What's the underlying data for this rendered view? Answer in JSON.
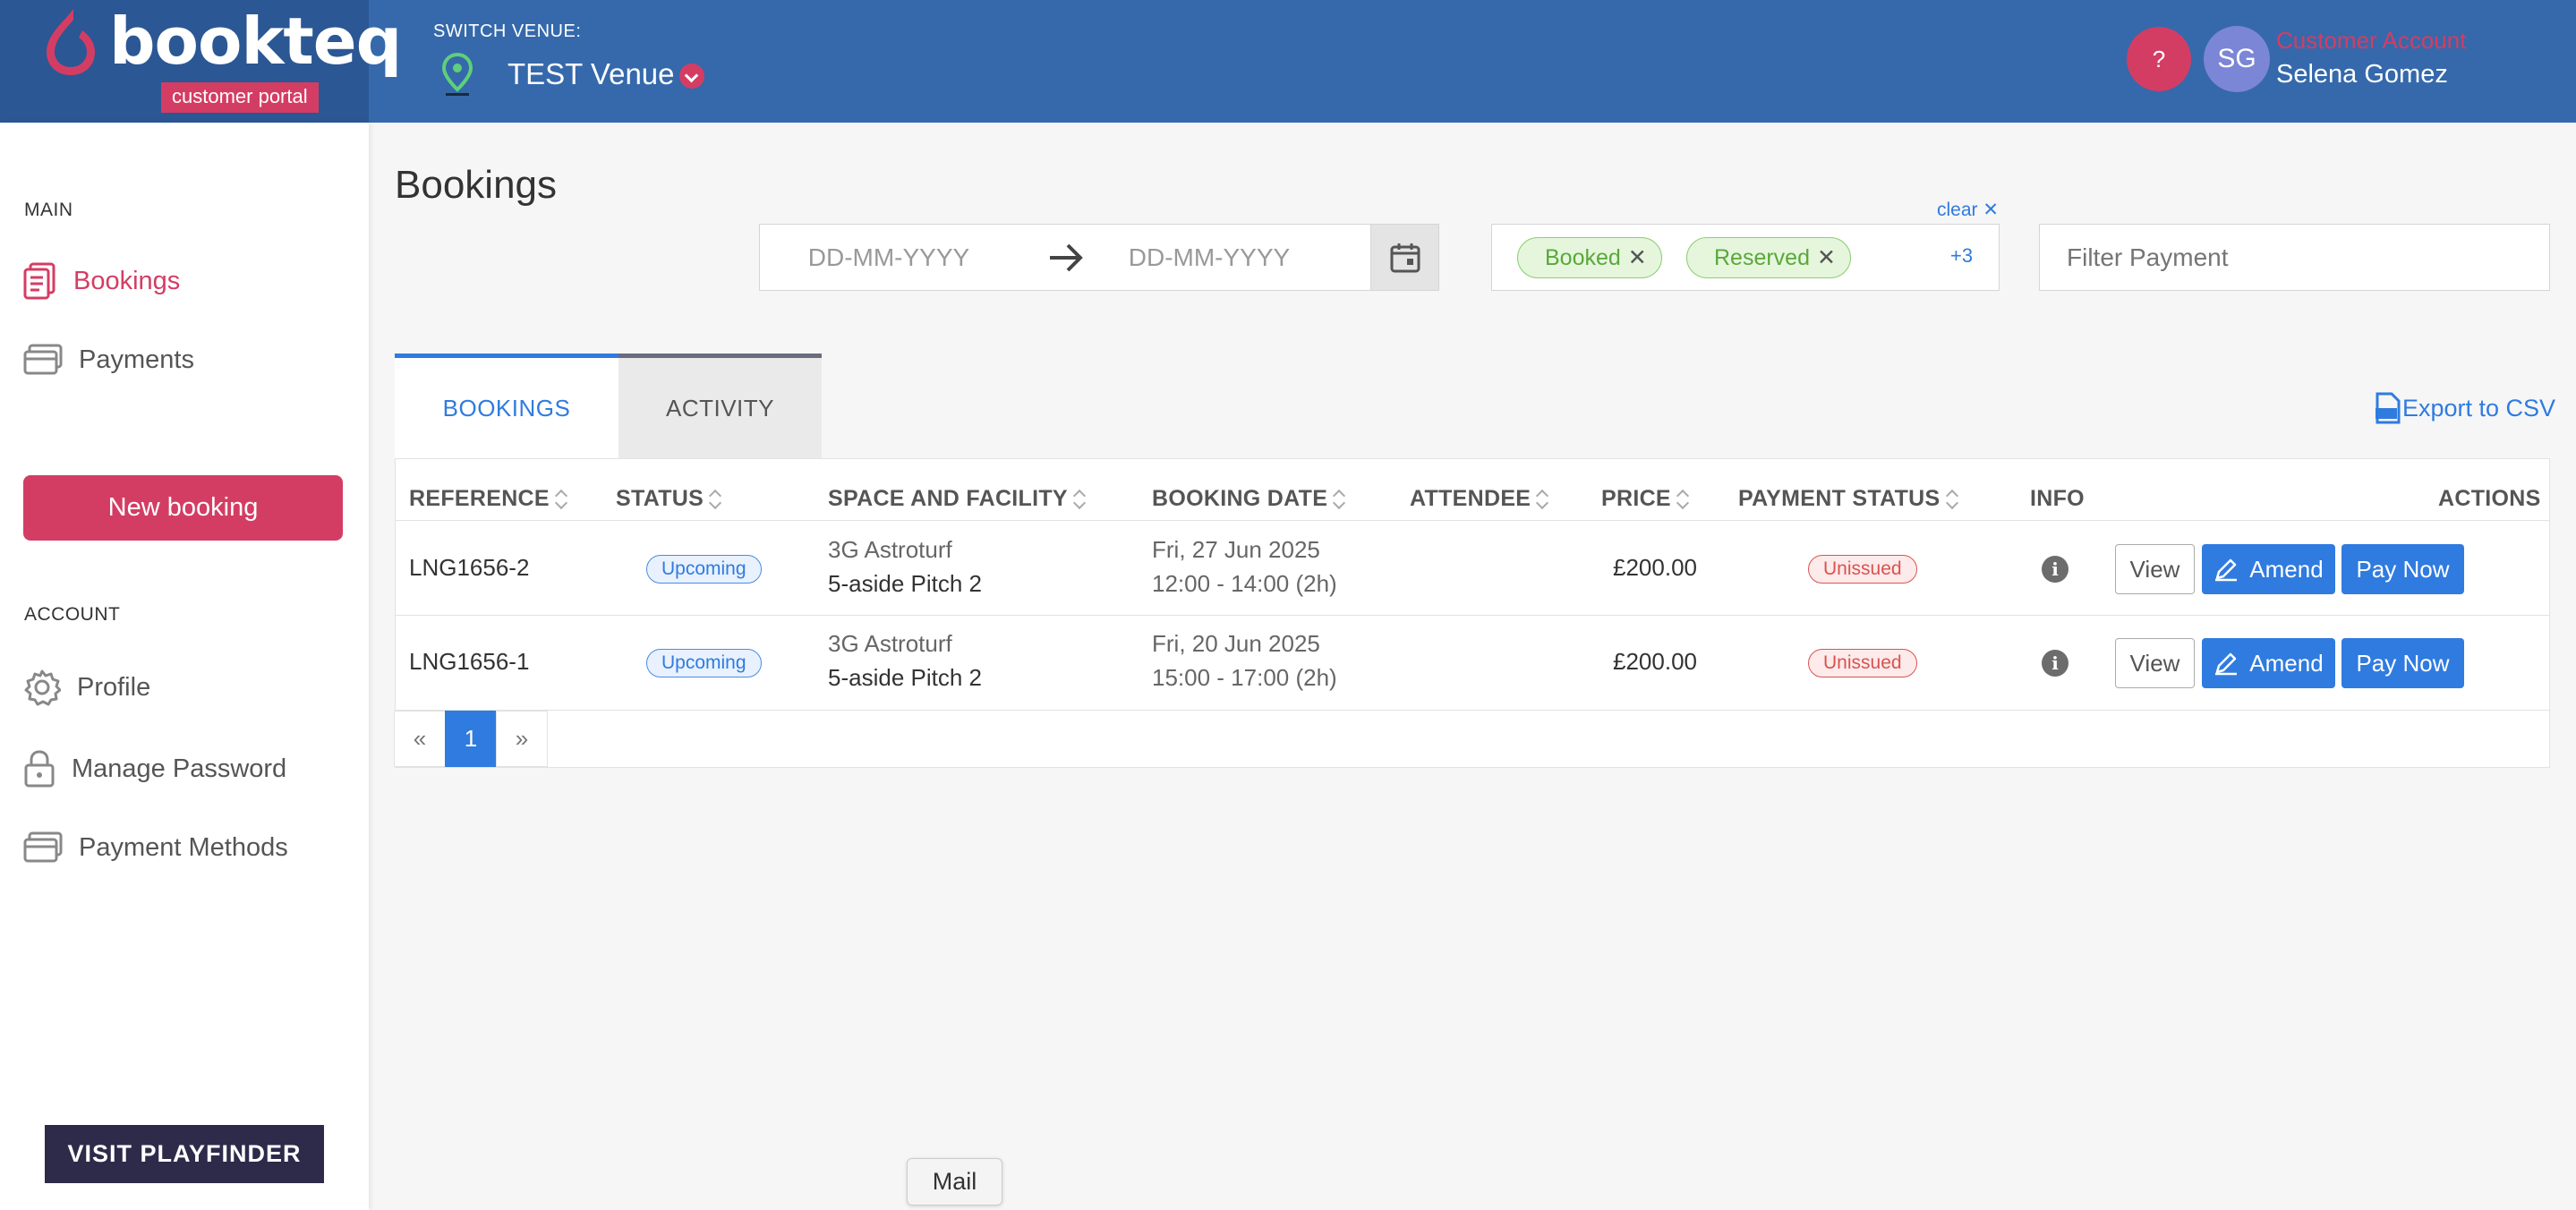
{
  "brand": {
    "name": "bookteq",
    "badge": "customer portal",
    "logo_icon": "bookteq-drop-icon"
  },
  "header": {
    "switch_label": "SWITCH VENUE:",
    "venue_name": "TEST Venue",
    "help_label": "?",
    "avatar_initials": "SG",
    "account_type": "Customer Account",
    "user_name": "Selena Gomez"
  },
  "sidebar": {
    "main_label": "MAIN",
    "main_items": [
      {
        "label": "Bookings",
        "icon": "bookings-icon",
        "active": true
      },
      {
        "label": "Payments",
        "icon": "card-icon",
        "active": false
      }
    ],
    "new_booking_label": "New booking",
    "account_label": "ACCOUNT",
    "account_items": [
      {
        "label": "Profile",
        "icon": "gear-icon"
      },
      {
        "label": "Manage Password",
        "icon": "lock-icon"
      },
      {
        "label": "Payment Methods",
        "icon": "card-icon"
      }
    ],
    "promo": "VISIT PLAYFINDER"
  },
  "page": {
    "title": "Bookings"
  },
  "filters": {
    "date_from_placeholder": "DD-MM-YYYY",
    "date_to_placeholder": "DD-MM-YYYY",
    "clear_label": "clear",
    "status_chips": [
      "Booked",
      "Reserved"
    ],
    "status_more": "+3",
    "payment_placeholder": "Filter Payment"
  },
  "tabs": {
    "bookings": "BOOKINGS",
    "activity": "ACTIVITY"
  },
  "export_label": "Export to CSV",
  "table": {
    "headers": {
      "reference": "REFERENCE",
      "status": "STATUS",
      "space": "SPACE AND FACILITY",
      "date": "BOOKING DATE",
      "attendee": "ATTENDEE",
      "price": "PRICE",
      "payment_status": "PAYMENT STATUS",
      "info": "INFO",
      "actions": "ACTIONS"
    },
    "rows": [
      {
        "reference": "LNG1656-2",
        "status": "Upcoming",
        "space": "3G Astroturf",
        "facility": "5-aside Pitch 2",
        "date": "Fri, 27 Jun 2025",
        "time": "12:00 - 14:00 (2h)",
        "attendee": "",
        "price": "£200.00",
        "payment_status": "Unissued"
      },
      {
        "reference": "LNG1656-1",
        "status": "Upcoming",
        "space": "3G Astroturf",
        "facility": "5-aside Pitch 2",
        "date": "Fri, 20 Jun 2025",
        "time": "15:00 - 17:00 (2h)",
        "attendee": "",
        "price": "£200.00",
        "payment_status": "Unissued"
      }
    ],
    "actions": {
      "view": "View",
      "amend": "Amend",
      "pay": "Pay Now"
    }
  },
  "pagination": {
    "prev": "«",
    "current": "1",
    "next": "»"
  },
  "tooltip": "Mail",
  "colors": {
    "header": "#3569ab",
    "brand_accent": "#d43d63",
    "primary": "#2f7be0"
  }
}
